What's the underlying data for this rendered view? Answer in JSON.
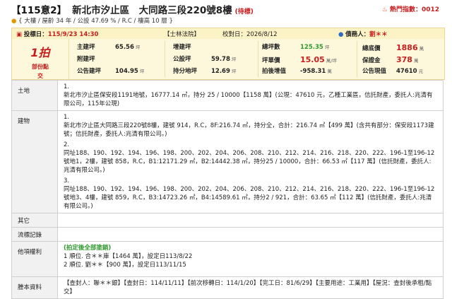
{
  "header": {
    "case_no": "【115意2】",
    "address": "新北市汐止區　大同路三段220號8樓",
    "status": "(待標)",
    "hot_label": "熱門指數：0012",
    "subinfo": "{ 大樓 / 屋齡 34 年 / 公設 47.69 % / R.C / 樓高 10 層 }"
  },
  "infobar": {
    "bid_date_label": "投標日：",
    "bid_date": "115/9/23 14:30",
    "court": "【士林法院】",
    "verify_date": "校對日：2026/8/12",
    "creditor_label": "債務人：",
    "creditor": "劉＊＊"
  },
  "summary": {
    "round": "1拍",
    "note_line1": "部份點",
    "note_line2": "交",
    "main_area_k": "主建坪",
    "main_area_v": "65.56",
    "main_area_u": "坪",
    "annex_k": "附建坪",
    "annex_v": "",
    "public_k": "公告建坪",
    "public_v": "104.95",
    "public_u": "坪",
    "add_k": "增建坪",
    "add_v": "",
    "common_k": "公設坪",
    "common_v": "59.78",
    "common_u": "坪",
    "land_k": "持分地坪",
    "land_v": "12.69",
    "land_u": "坪",
    "total_k": "總坪數",
    "total_v": "125.35",
    "total_u": "坪",
    "unit_k": "坪單價",
    "unit_v": "15.05",
    "unit_u": "萬/坪",
    "after_k": "拍後增值",
    "after_v": "-958.31",
    "after_u": "萬",
    "base_k": "總底價",
    "base_v": "1886",
    "base_u": "萬",
    "deposit_k": "保證金",
    "deposit_v": "378",
    "deposit_u": "萬",
    "ann_k": "公告現值",
    "ann_v": "47610",
    "ann_u": "元"
  },
  "table": {
    "land_label": "土地",
    "land_items": [
      {
        "n": "1.",
        "t": "新北市汐止區保安段1191地號，16777.14 ㎡，持分 25 / 10000【1158 萬】(公現：47610 元，乙種工業區，信託財產，委託人:兆清有限公司，115年公現)"
      }
    ],
    "building_label": "建物",
    "building_items": [
      {
        "n": "1.",
        "t": "新北市汐止區大同路三段220號8樓，建號 914，R.C，8F:216.74 ㎡，持分全，合計：216.74 ㎡【499 萬】(含共有部分：保安段1173建號；信託財產，委託人:兆清有限公司。)"
      },
      {
        "n": "2.",
        "t": "同址188、190、192、194、196、198、200、202、204、206、208、210、212、214、216、218、220、222、196-1至196-12號地1，2樓，建號 858，R.C，B1:12171.29 ㎡，B2:14442.38 ㎡，持分25 / 10000，合計：66.53 ㎡【117 萬】(信託財產，委託人:兆清有限公司。)"
      },
      {
        "n": "3.",
        "t": "同址188、190、192、194、196、198、200、202、204、206、208、210、212、214、216、218、220、222、196-1至196-12號地3、4樓，建號 859，R.C，B3:14723.26 ㎡，B4:14589.61 ㎡，持分2 / 921，合計：63.65 ㎡【112 萬】(信託財產，委託人:兆清有限公司。)"
      }
    ],
    "other_label": "其它",
    "process_label": "流標記錄",
    "rights_label": "他項權利",
    "rights_head": "(拍定後全部塗銷)",
    "rights_items": [
      {
        "n": "1",
        "t": "順位. 合＊＊庫【1464 萬】，設定日113/8/22"
      },
      {
        "n": "2",
        "t": "順位. 劉＊＊【900 萬】，設定日113/11/15"
      }
    ],
    "transcript_label": "謄本資料",
    "transcript_text": "【查封人：聯＊＊銀】【查封日：114/11/11】【前次移轉日：114/1/20】【完工日：81/6/29】【主要用途：工業用】【屋況：查封後承租/點交】"
  }
}
